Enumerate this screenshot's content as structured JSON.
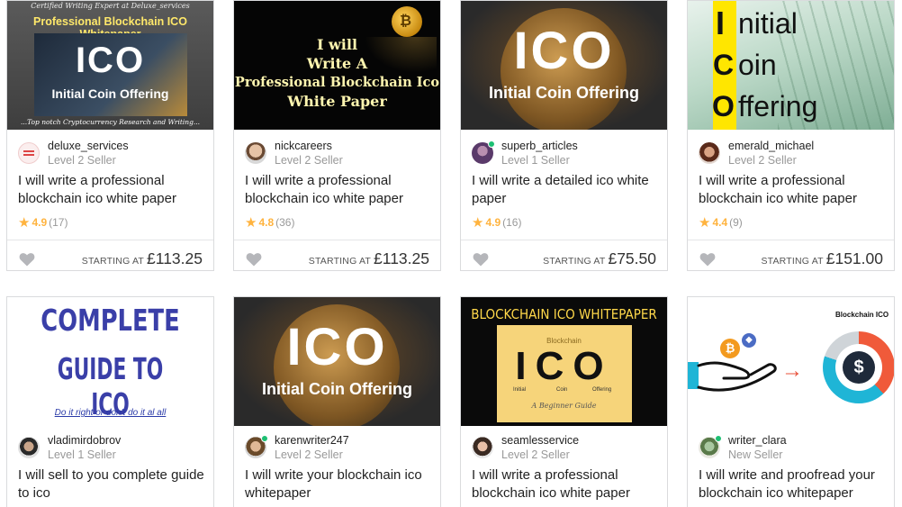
{
  "gigs": [
    {
      "thumb": {
        "line_top": "Certified Writing Expert at Deluxe_services",
        "banner": "Professional Blockchain ICO Whitepaper",
        "big": "ICO",
        "sub": "Initial Coin Offering",
        "footer": "...Top notch Cryptocurrency Research and Writing..."
      },
      "seller": "deluxe_services",
      "level": "Level 2 Seller",
      "online": false,
      "title": "I will write a professional blockchain ico white paper",
      "rating": "4.9",
      "reviews": "(17)",
      "starting": "STARTING AT",
      "price": "£113.25"
    },
    {
      "thumb": {
        "lines": [
          "I will",
          "Write A",
          "Professional Blockchain Ico",
          "White Paper"
        ]
      },
      "seller": "nickcareers",
      "level": "Level 2 Seller",
      "online": false,
      "title": "I will write a professional blockchain ico white paper",
      "rating": "4.8",
      "reviews": "(36)",
      "starting": "STARTING AT",
      "price": "£113.25"
    },
    {
      "thumb": {
        "big": "ICO",
        "sub": "Initial Coin Offering"
      },
      "seller": "superb_articles",
      "level": "Level 1 Seller",
      "online": true,
      "title": "I will write a detailed ico white paper",
      "rating": "4.9",
      "reviews": "(16)",
      "starting": "STARTING AT",
      "price": "£75.50"
    },
    {
      "thumb": {
        "l1": "I",
        "r1": "nitial",
        "l2": "C",
        "r2": "oin",
        "l3": "O",
        "r3": "ffering"
      },
      "seller": "emerald_michael",
      "level": "Level 2 Seller",
      "online": false,
      "title": "I will write a professional blockchain ico white paper",
      "rating": "4.4",
      "reviews": "(9)",
      "starting": "STARTING AT",
      "price": "£151.00"
    },
    {
      "thumb": {
        "line1": "COMPLETE",
        "line2": "GUIDE TO ICO",
        "link": "Do it right or don't do it al all"
      },
      "seller": "vladimirdobrov",
      "level": "Level 1 Seller",
      "online": false,
      "title": "I will sell to you complete guide to ico"
    },
    {
      "thumb": {
        "big": "ICO",
        "sub": "Initial Coin Offering"
      },
      "seller": "karenwriter247",
      "level": "Level 2 Seller",
      "online": true,
      "title": "I will write your blockchain ico whitepaper"
    },
    {
      "thumb": {
        "header": "BLOCKCHAIN ICO WHITEPAPER",
        "small": "Blockchain",
        "big": "ICO",
        "w1": "Initial",
        "w2": "Coin",
        "w3": "Offering",
        "guide": "A Beginner Guide"
      },
      "seller": "seamlesservice",
      "level": "Level 2 Seller",
      "online": false,
      "title": "I will write a professional blockchain ico white paper"
    },
    {
      "thumb": {
        "label": "Blockchain ICO"
      },
      "seller": "writer_clara",
      "level": "New Seller",
      "online": true,
      "title": "I will write and proofread your blockchain ico whitepaper"
    }
  ],
  "colors": {
    "star": "#ffb33e",
    "online": "#1dbf73",
    "border": "#dadbdd",
    "heart": "#b5b6ba",
    "ico_yellow": "#ffe600",
    "guide_blue": "#3a3fa8"
  },
  "icons": {
    "heart": "heart-icon",
    "star": "star-icon"
  }
}
